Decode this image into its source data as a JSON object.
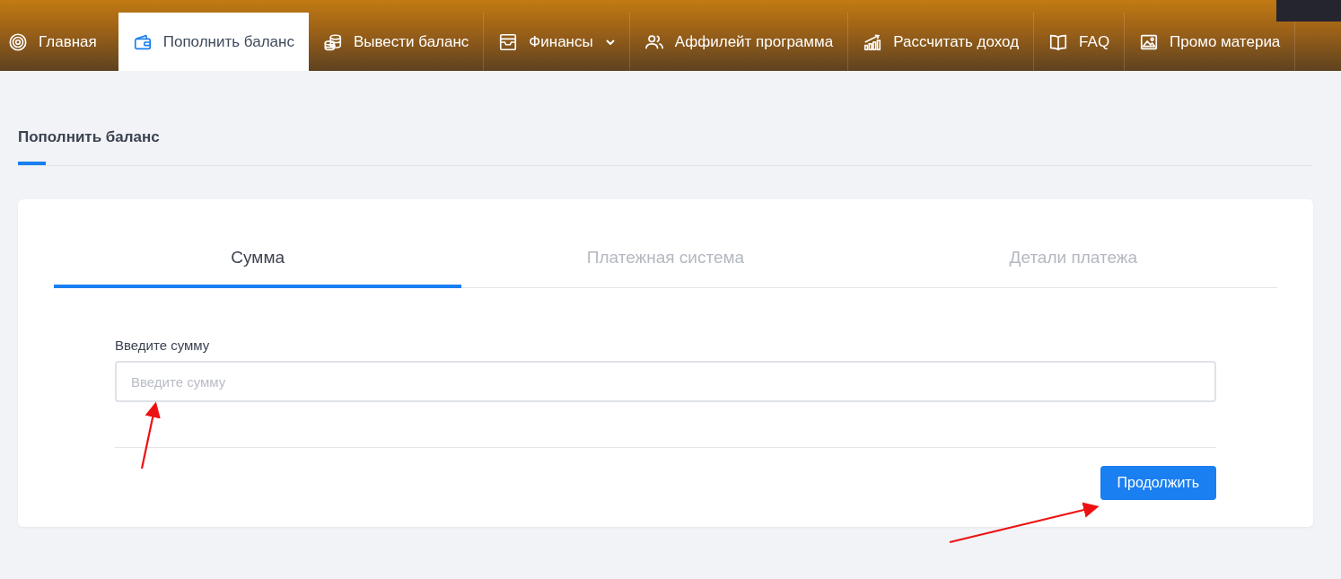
{
  "nav": [
    {
      "label": "Главная",
      "selected": false,
      "kind": "link"
    },
    {
      "label": "Пополнить баланс",
      "selected": true,
      "kind": "link"
    },
    {
      "label": "Вывести баланс",
      "selected": false,
      "kind": "link"
    },
    {
      "label": "Финансы",
      "selected": false,
      "kind": "dropdown"
    },
    {
      "label": "Аффилейт программа",
      "selected": false,
      "kind": "link"
    },
    {
      "label": "Рассчитать доход",
      "selected": false,
      "kind": "link"
    },
    {
      "label": "FAQ",
      "selected": false,
      "kind": "link"
    },
    {
      "label": "Промо материа",
      "selected": false,
      "kind": "link"
    }
  ],
  "page_title": "Пополнить баланс",
  "steps": [
    {
      "label": "Сумма",
      "selected": true
    },
    {
      "label": "Платежная система",
      "selected": false
    },
    {
      "label": "Детали платежа",
      "selected": false
    }
  ],
  "form": {
    "label": "Введите сумму",
    "placeholder": "Введите сумму",
    "button": "Продолжить"
  }
}
